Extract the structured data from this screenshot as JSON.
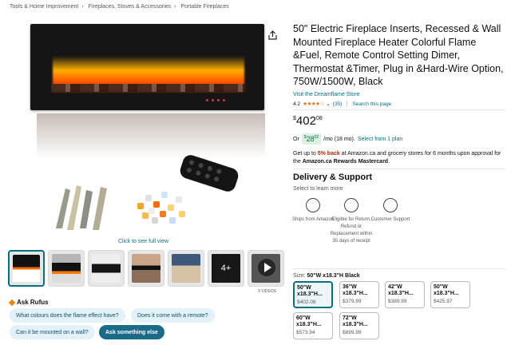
{
  "breadcrumb": [
    "Tools & Home Improvement",
    "Fireplaces, Stoves & Accessories",
    "Portable Fireplaces"
  ],
  "product": {
    "title": "50\" Electric Fireplace Inserts, Recessed & Wall Mounted Fireplace Heater Colorful Flame &Fuel, Remote Control Setting Dimer, Thermostat &Timer, Plug in &Hard-Wire Option, 750W/1500W, Black",
    "store_link": "Visit the Dreamflame Store",
    "rating": "4.2",
    "stars": "★★★★☆",
    "reviews": "(35)",
    "search_link": "Search this page"
  },
  "price": {
    "currency": "$",
    "whole": "402",
    "fraction": "08"
  },
  "monthly": {
    "prefix": "Or",
    "currency": "$",
    "whole": "28",
    "fraction": "02",
    "suffix": "/mo (18 mo).",
    "link": "Select from 1 plan"
  },
  "cashback": {
    "part1": "Get up to ",
    "highlight": "5% back",
    "part2": " at Amazon.ca and grocery stores for 6 months upon approval for the ",
    "card": "Amazon.ca Rewards Mastercard",
    "end": "."
  },
  "delivery": {
    "title": "Delivery & Support",
    "subtitle": "Select to learn more",
    "features": [
      {
        "icon": "truck-icon",
        "label": "Ships from Amazon"
      },
      {
        "icon": "return-icon",
        "label": "Eligible for Return, Refund or Replacement within 30 days of receipt"
      },
      {
        "icon": "headset-icon",
        "label": "Customer Support"
      }
    ]
  },
  "size": {
    "label": "Size:",
    "selected": "50\"W x18.3\"H Black",
    "options": [
      {
        "name": "50\"W x18.3\"H...",
        "price": "$402.08"
      },
      {
        "name": "36\"W x18.3\"H...",
        "price": "$379.99"
      },
      {
        "name": "42\"W x18.3\"H...",
        "price": "$389.99"
      },
      {
        "name": "50\"W x18.3\"H...",
        "price": "$425.97"
      },
      {
        "name": "60\"W x18.3\"H...",
        "price": "$573.94"
      },
      {
        "name": "72\"W x18.3\"H...",
        "price": "$899.99"
      }
    ]
  },
  "gallery": {
    "full_view": "Click to see full view",
    "more_count": "4+",
    "videos_label": "3 VIDEOS"
  },
  "rufus": {
    "title": "Ask Rufus",
    "chips": [
      "What colours does the flame effect have?",
      "Does it come with a remote?",
      "Can it be mounted on a wall?",
      "Ask something else"
    ]
  },
  "colors": {
    "link": "#007185",
    "accent": "#de7921",
    "deal": "#b12704"
  }
}
